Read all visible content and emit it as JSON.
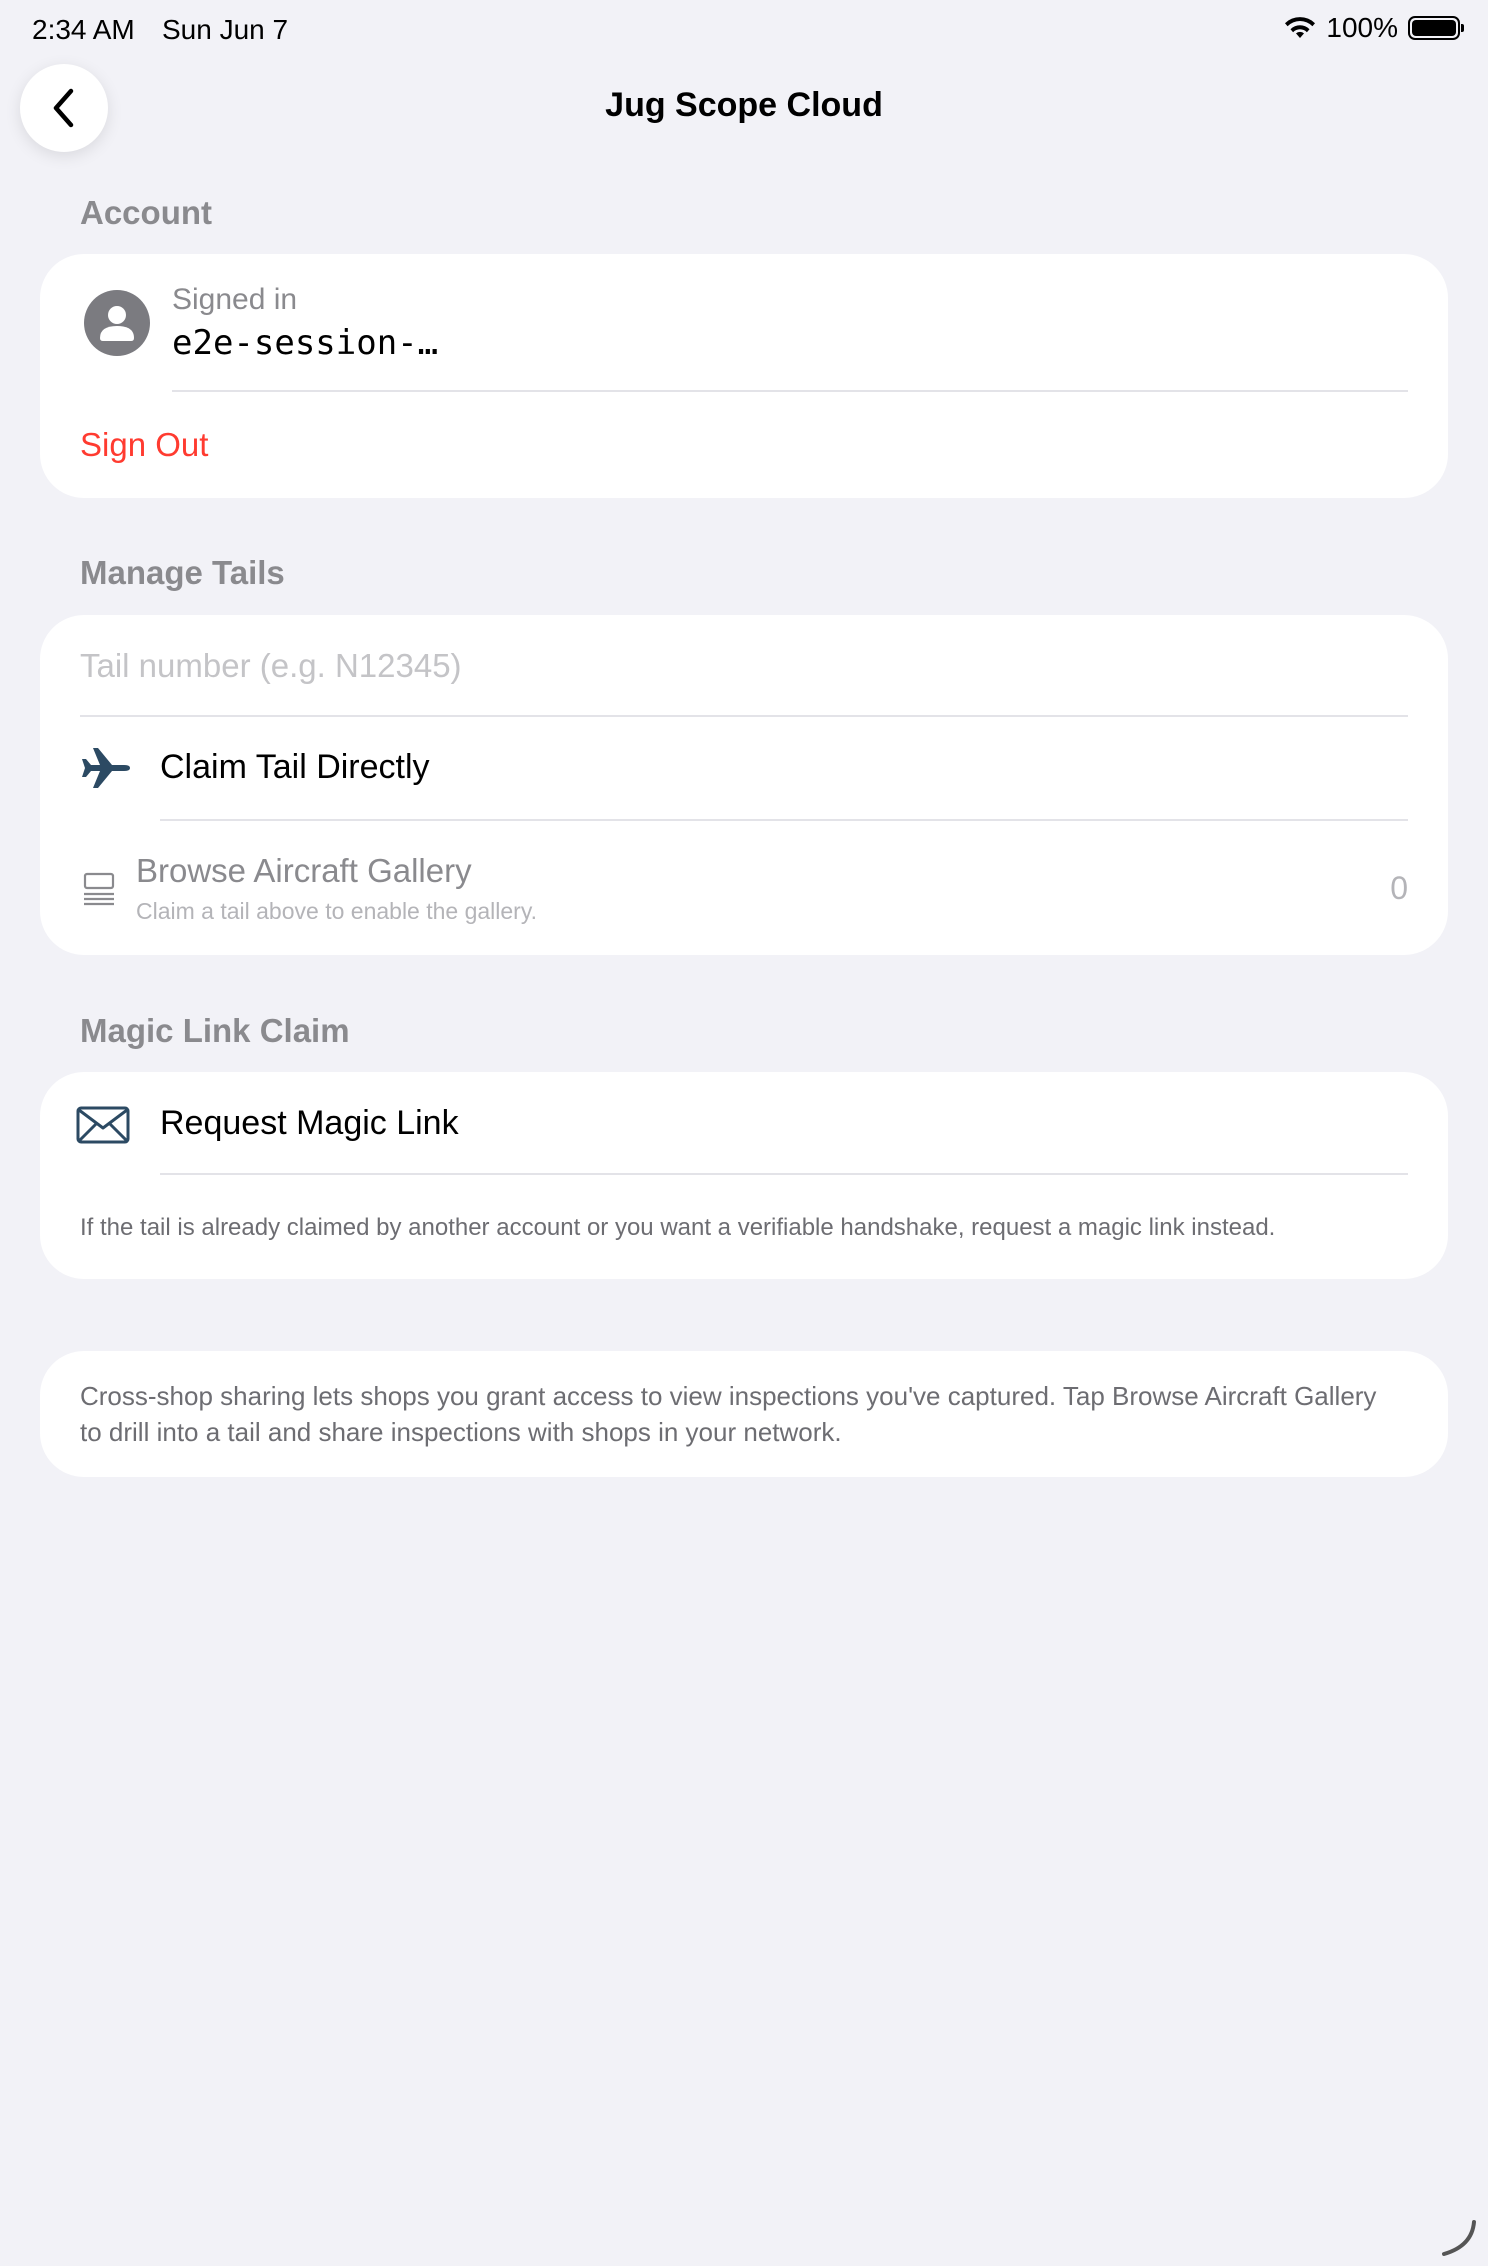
{
  "status_bar": {
    "time": "2:34 AM",
    "date": "Sun Jun 7",
    "battery": "100%",
    "icons": [
      "wifi-icon",
      "battery-icon"
    ]
  },
  "nav": {
    "title": "Jug Scope Cloud",
    "back_icon": "chevron-left-icon"
  },
  "account": {
    "header": "Account",
    "signed_in_label": "Signed in",
    "signed_in_value": "e2e-session-…",
    "sign_out": "Sign Out",
    "avatar_icon": "person-circle-icon"
  },
  "manage_tails": {
    "header": "Manage Tails",
    "tail_placeholder": "Tail number (e.g. N12345)",
    "tail_value": "",
    "claim_label": "Claim Tail Directly",
    "claim_icon": "airplane-icon",
    "gallery_label": "Browse Aircraft Gallery",
    "gallery_sub": "Claim a tail above to enable the gallery.",
    "gallery_count": "0",
    "gallery_icon": "gallery-list-icon"
  },
  "magic_link": {
    "header": "Magic Link Claim",
    "request_label": "Request Magic Link",
    "request_icon": "envelope-icon",
    "footnote": "If the tail is already claimed by another account or you want a verifiable handshake, request a magic link instead."
  },
  "info": {
    "text": "Cross-shop sharing lets shops you grant access to view inspections you've captured. Tap Browse Aircraft Gallery to drill into a tail and share inspections with shops in your network."
  },
  "colors": {
    "background": "#f2f2f7",
    "destructive": "#ff3b30",
    "icon_accent": "#2c4a63",
    "secondary_text": "#8a8a8e"
  }
}
